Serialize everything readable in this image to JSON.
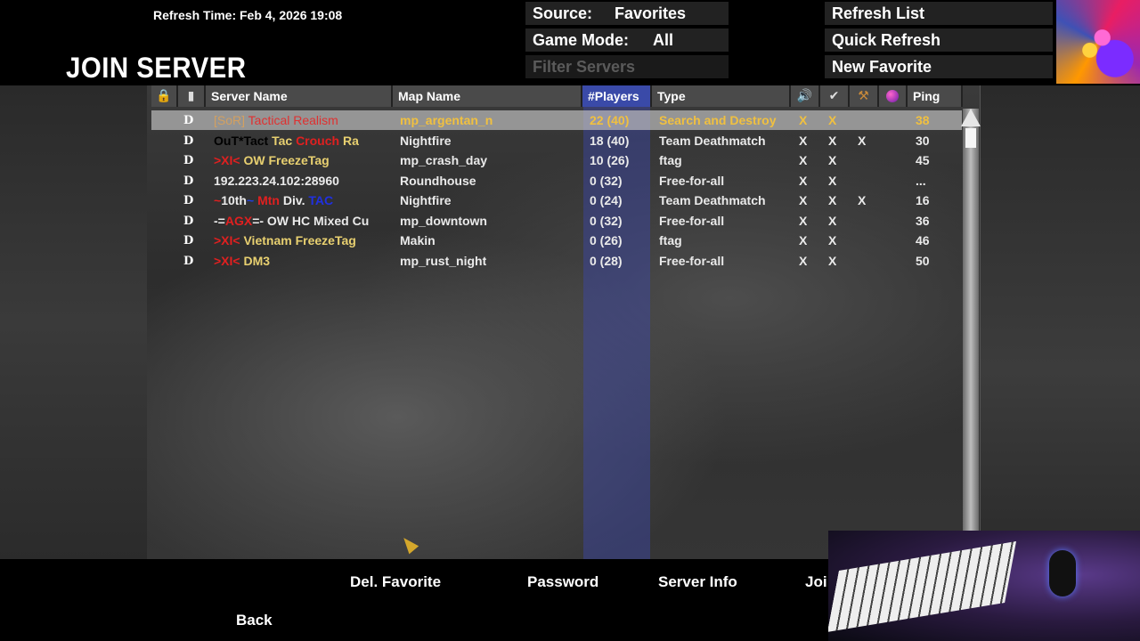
{
  "header": {
    "refresh_time": "Refresh Time: Feb 4, 2026   19:08",
    "title": "JOIN SERVER",
    "source_label": "Source:",
    "source_value": "Favorites",
    "mode_label": "Game Mode:",
    "mode_value": "All",
    "filter_placeholder": "Filter Servers",
    "refresh_list": "Refresh List",
    "quick_refresh": "Quick Refresh",
    "new_favorite": "New Favorite"
  },
  "columns": {
    "server_name": "Server Name",
    "map_name": "Map Name",
    "players": "#Players",
    "type": "Type",
    "ping": "Ping",
    "icons": [
      "lock-icon",
      "shield-icon",
      "speaker-icon",
      "checkmark-icon",
      "hammer-icon",
      "globe-icon"
    ]
  },
  "servers": [
    {
      "d": "D",
      "name": "[SoR] Tactical Realism",
      "map": "mp_argentan_n",
      "players": "22 (40)",
      "type": "Search and Destroy",
      "c1": "X",
      "c2": "X",
      "c3": "",
      "ping": "38",
      "selected": true
    },
    {
      "d": "D",
      "name": "OuT*Tact Tac Crouch Ra",
      "map": "Nightfire",
      "players": "18 (40)",
      "type": "Team Deathmatch",
      "c1": "X",
      "c2": "X",
      "c3": "X",
      "ping": "30"
    },
    {
      "d": "D",
      "name": ">XI< OW FreezeTag",
      "map": "mp_crash_day",
      "players": "10 (26)",
      "type": "ftag",
      "c1": "X",
      "c2": "X",
      "c3": "",
      "ping": "45"
    },
    {
      "d": "D",
      "name": "192.223.24.102:28960",
      "map": "Roundhouse",
      "players": "0 (32)",
      "type": "Free-for-all",
      "c1": "X",
      "c2": "X",
      "c3": "",
      "ping": "..."
    },
    {
      "d": "D",
      "name": "~10th~ Mtn Div. TAC",
      "map": "Nightfire",
      "players": "0 (24)",
      "type": "Team Deathmatch",
      "c1": "X",
      "c2": "X",
      "c3": "X",
      "ping": "16"
    },
    {
      "d": "D",
      "name": "-=AGX=- OW HC Mixed Cu",
      "map": "mp_downtown",
      "players": "0 (32)",
      "type": "Free-for-all",
      "c1": "X",
      "c2": "X",
      "c3": "",
      "ping": "36"
    },
    {
      "d": "D",
      "name": ">XI< Vietnam FreezeTag",
      "map": "Makin",
      "players": "0 (26)",
      "type": "ftag",
      "c1": "X",
      "c2": "X",
      "c3": "",
      "ping": "46"
    },
    {
      "d": "D",
      "name": ">XI< DM3",
      "map": "mp_rust_night",
      "players": "0 (28)",
      "type": "Free-for-all",
      "c1": "X",
      "c2": "X",
      "c3": "",
      "ping": "50"
    }
  ],
  "footer": {
    "del_favorite": "Del. Favorite",
    "password": "Password",
    "server_info": "Server Info",
    "join": "Joi",
    "back": "Back"
  }
}
